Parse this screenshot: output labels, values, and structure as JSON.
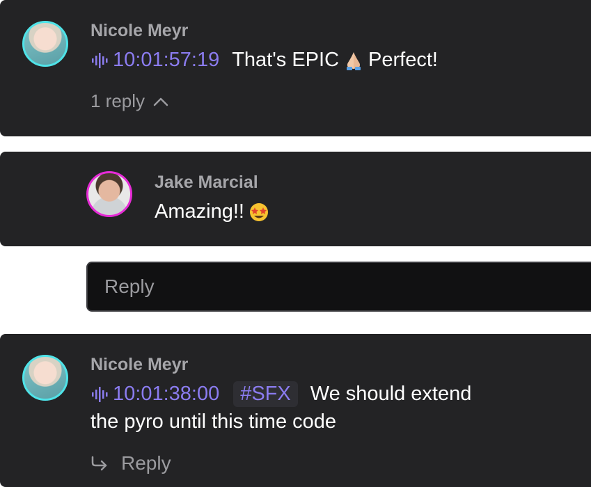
{
  "thread": {
    "comment1": {
      "author": "Nicole Meyr",
      "timecode": "10:01:57:19",
      "text_before": "That's EPIC",
      "emoji": "folded-hands",
      "text_after": "Perfect!",
      "replies_label": "1 reply"
    },
    "reply1": {
      "author": "Jake Marcial",
      "text": "Amazing!!",
      "emoji": "star-struck"
    },
    "reply_input": {
      "placeholder": "Reply"
    },
    "comment2": {
      "author": "Nicole Meyr",
      "timecode": "10:01:38:00",
      "tag": "#SFX",
      "text_line1": "We should extend",
      "text_line2": "the pyro until this time code",
      "reply_label": "Reply"
    }
  },
  "colors": {
    "card_bg": "#232325",
    "timecode": "#8b7cf0",
    "nicole_ring": "#4fe3e8",
    "jake_ring": "#e62bd6"
  },
  "icons": [
    "audio-waveform-icon",
    "folded-hands-icon",
    "star-struck-icon",
    "chevron-up-icon",
    "reply-arrow-icon"
  ]
}
